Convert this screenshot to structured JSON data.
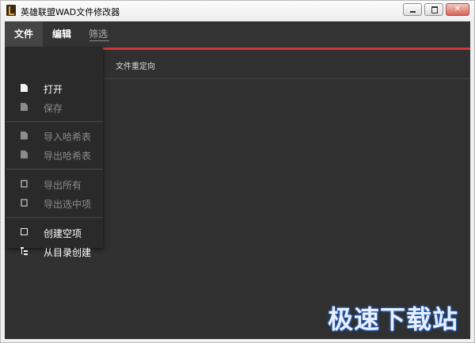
{
  "window": {
    "title": "英雄联盟WAD文件修改器"
  },
  "menubar": {
    "file": "文件",
    "edit": "编辑",
    "filter": "筛选"
  },
  "main": {
    "header_label": "文件重定向"
  },
  "file_menu": {
    "items": [
      {
        "label": "打开",
        "icon": "file-icon",
        "enabled": true
      },
      {
        "label": "保存",
        "icon": "save-file-icon",
        "enabled": false
      },
      {
        "label": "导入哈希表",
        "icon": "import-sheet-icon",
        "enabled": false
      },
      {
        "label": "导出哈希表",
        "icon": "export-sheet-icon",
        "enabled": false
      },
      {
        "label": "导出所有",
        "icon": "export-all-icon",
        "enabled": false
      },
      {
        "label": "导出选中项",
        "icon": "export-selected-icon",
        "enabled": false
      },
      {
        "label": "创建空项",
        "icon": "empty-square-icon",
        "enabled": true
      },
      {
        "label": "从目录创建",
        "icon": "tree-icon",
        "enabled": true
      }
    ]
  },
  "colors": {
    "accent_red": "#d03838",
    "background": "#303030",
    "menu_bg": "#2a2a2a"
  },
  "watermark": {
    "text": "极速下载站"
  }
}
